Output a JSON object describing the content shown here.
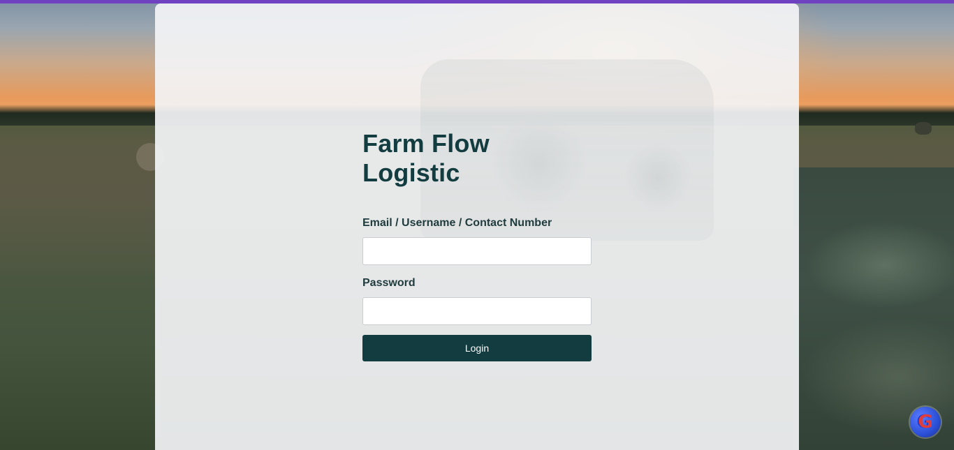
{
  "app": {
    "title": "Farm Flow Logistic",
    "accent_color": "#6f42c1",
    "brand_color": "#123c3f"
  },
  "form": {
    "identifier_label": "Email / Username / Contact Number",
    "identifier_value": "",
    "identifier_placeholder": "",
    "password_label": "Password",
    "password_value": "",
    "password_placeholder": "",
    "login_label": "Login"
  },
  "badge": {
    "icon": "g-logo-icon",
    "glyph": "G"
  }
}
